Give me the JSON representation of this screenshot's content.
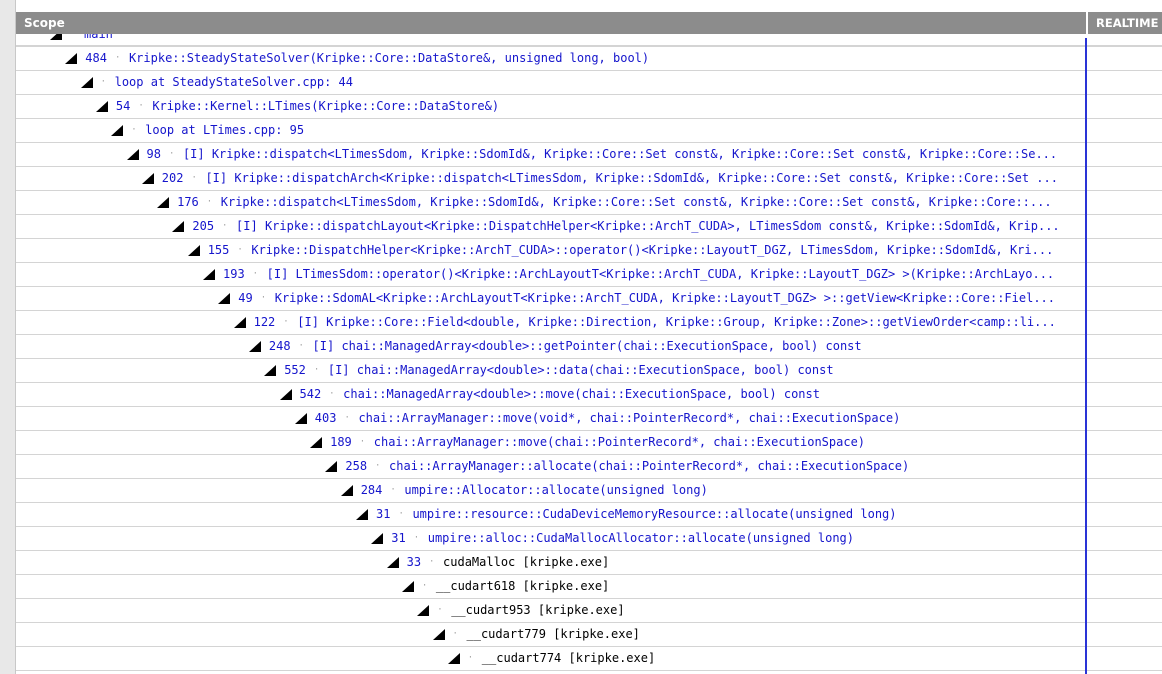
{
  "header": {
    "scope_label": "Scope",
    "realtime_label": "REALTIME"
  },
  "rows": [
    {
      "count": "",
      "label": "main",
      "plain": false
    },
    {
      "count": "484",
      "label": "Kripke::SteadyStateSolver(Kripke::Core::DataStore&, unsigned long, bool)",
      "plain": false
    },
    {
      "count": "",
      "label": "loop at SteadyStateSolver.cpp: 44",
      "plain": false
    },
    {
      "count": "54",
      "label": "Kripke::Kernel::LTimes(Kripke::Core::DataStore&)",
      "plain": false
    },
    {
      "count": "",
      "label": "loop at LTimes.cpp: 95",
      "plain": false
    },
    {
      "count": "98",
      "label": "[I] Kripke::dispatch<LTimesSdom, Kripke::SdomId&, Kripke::Core::Set const&, Kripke::Core::Set const&, Kripke::Core::Se...",
      "plain": false
    },
    {
      "count": "202",
      "label": "[I] Kripke::dispatchArch<Kripke::dispatch<LTimesSdom, Kripke::SdomId&, Kripke::Core::Set const&, Kripke::Core::Set ...",
      "plain": false
    },
    {
      "count": "176",
      "label": "Kripke::dispatch<LTimesSdom, Kripke::SdomId&, Kripke::Core::Set const&, Kripke::Core::Set const&, Kripke::Core::...",
      "plain": false
    },
    {
      "count": "205",
      "label": "[I] Kripke::dispatchLayout<Kripke::DispatchHelper<Kripke::ArchT_CUDA>, LTimesSdom const&, Kripke::SdomId&, Krip...",
      "plain": false
    },
    {
      "count": "155",
      "label": "Kripke::DispatchHelper<Kripke::ArchT_CUDA>::operator()<Kripke::LayoutT_DGZ, LTimesSdom, Kripke::SdomId&, Kri...",
      "plain": false
    },
    {
      "count": "193",
      "label": "[I] LTimesSdom::operator()<Kripke::ArchLayoutT<Kripke::ArchT_CUDA, Kripke::LayoutT_DGZ> >(Kripke::ArchLayo...",
      "plain": false
    },
    {
      "count": "49",
      "label": "Kripke::SdomAL<Kripke::ArchLayoutT<Kripke::ArchT_CUDA, Kripke::LayoutT_DGZ> >::getView<Kripke::Core::Fiel...",
      "plain": false
    },
    {
      "count": "122",
      "label": "[I] Kripke::Core::Field<double, Kripke::Direction, Kripke::Group, Kripke::Zone>::getViewOrder<camp::li...",
      "plain": false
    },
    {
      "count": "248",
      "label": "[I] chai::ManagedArray<double>::getPointer(chai::ExecutionSpace, bool) const",
      "plain": false
    },
    {
      "count": "552",
      "label": "[I] chai::ManagedArray<double>::data(chai::ExecutionSpace, bool) const",
      "plain": false
    },
    {
      "count": "542",
      "label": "chai::ManagedArray<double>::move(chai::ExecutionSpace, bool) const",
      "plain": false
    },
    {
      "count": "403",
      "label": "chai::ArrayManager::move(void*, chai::PointerRecord*, chai::ExecutionSpace)",
      "plain": false
    },
    {
      "count": "189",
      "label": "chai::ArrayManager::move(chai::PointerRecord*, chai::ExecutionSpace)",
      "plain": false
    },
    {
      "count": "258",
      "label": "chai::ArrayManager::allocate(chai::PointerRecord*, chai::ExecutionSpace)",
      "plain": false
    },
    {
      "count": "284",
      "label": "umpire::Allocator::allocate(unsigned long)",
      "plain": false
    },
    {
      "count": "31",
      "label": "umpire::resource::CudaDeviceMemoryResource::allocate(unsigned long)",
      "plain": false
    },
    {
      "count": "31",
      "label": "umpire::alloc::CudaMallocAllocator::allocate(unsigned long)",
      "plain": false
    },
    {
      "count": "33",
      "label": "cudaMalloc [kripke.exe]",
      "plain": true
    },
    {
      "count": "",
      "label": "__cudart618 [kripke.exe]",
      "plain": true
    },
    {
      "count": "",
      "label": "__cudart953 [kripke.exe]",
      "plain": true
    },
    {
      "count": "",
      "label": "__cudart779 [kripke.exe]",
      "plain": true
    },
    {
      "count": "",
      "label": "__cudart774 [kripke.exe]",
      "plain": true
    }
  ]
}
